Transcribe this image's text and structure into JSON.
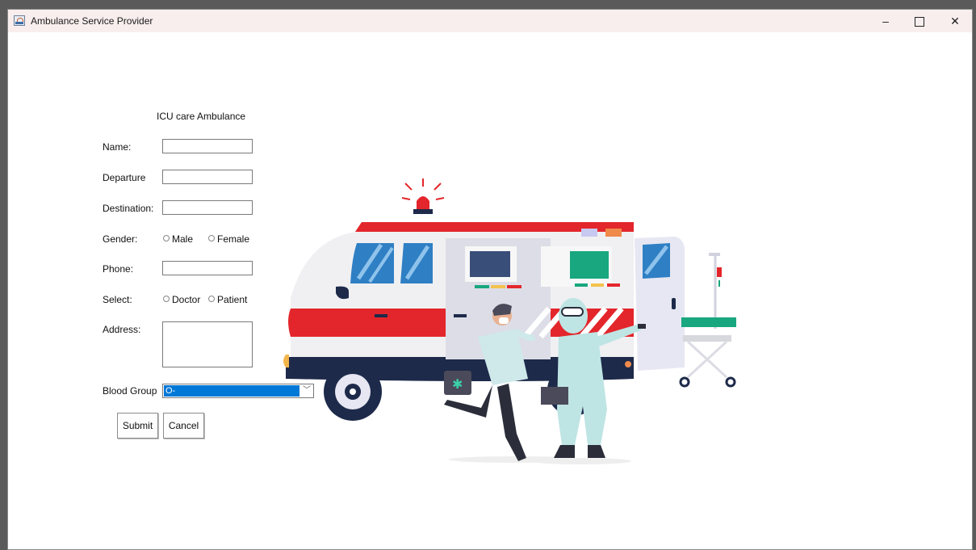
{
  "window": {
    "title": "Ambulance Service Provider",
    "controls": {
      "minimize": "–",
      "close": "✕"
    }
  },
  "form": {
    "heading": "ICU care Ambulance",
    "name_label": "Name:",
    "name_value": "",
    "departure_label": "Departure",
    "departure_value": "",
    "destination_label": "Destination:",
    "destination_value": "",
    "gender_label": "Gender:",
    "gender_options": [
      "Male",
      "Female"
    ],
    "phone_label": "Phone:",
    "phone_value": "",
    "select_label": "Select:",
    "select_options": [
      "Doctor",
      "Patient"
    ],
    "address_label": "Address:",
    "address_value": "",
    "blood_group_label": "Blood Group",
    "blood_group_value": "O-",
    "submit_label": "Submit",
    "cancel_label": "Cancel"
  },
  "colors": {
    "selection": "#0078d7",
    "ambulance_red": "#e3262b",
    "ambulance_navy": "#1d2a4a",
    "titlebar": "#f9eeee"
  },
  "icons": {
    "app": "java-app-icon",
    "illustration": "ambulance-with-medics"
  }
}
